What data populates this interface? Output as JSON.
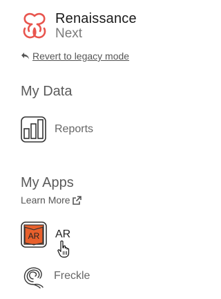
{
  "brand": {
    "name_line1": "Renaissance",
    "name_line2": "Next"
  },
  "revert_link": "Revert to legacy mode",
  "sections": {
    "my_data": {
      "title": "My Data",
      "items": [
        {
          "label": "Reports",
          "icon": "bar-chart-icon"
        }
      ]
    },
    "my_apps": {
      "title": "My Apps",
      "learn_more": "Learn More",
      "items": [
        {
          "label": "AR",
          "icon": "ar-book-icon"
        },
        {
          "label": "Freckle",
          "icon": "freckle-swirl-icon"
        }
      ]
    }
  },
  "colors": {
    "logo_red": "#e8554e",
    "ar_orange": "#e8602c"
  }
}
